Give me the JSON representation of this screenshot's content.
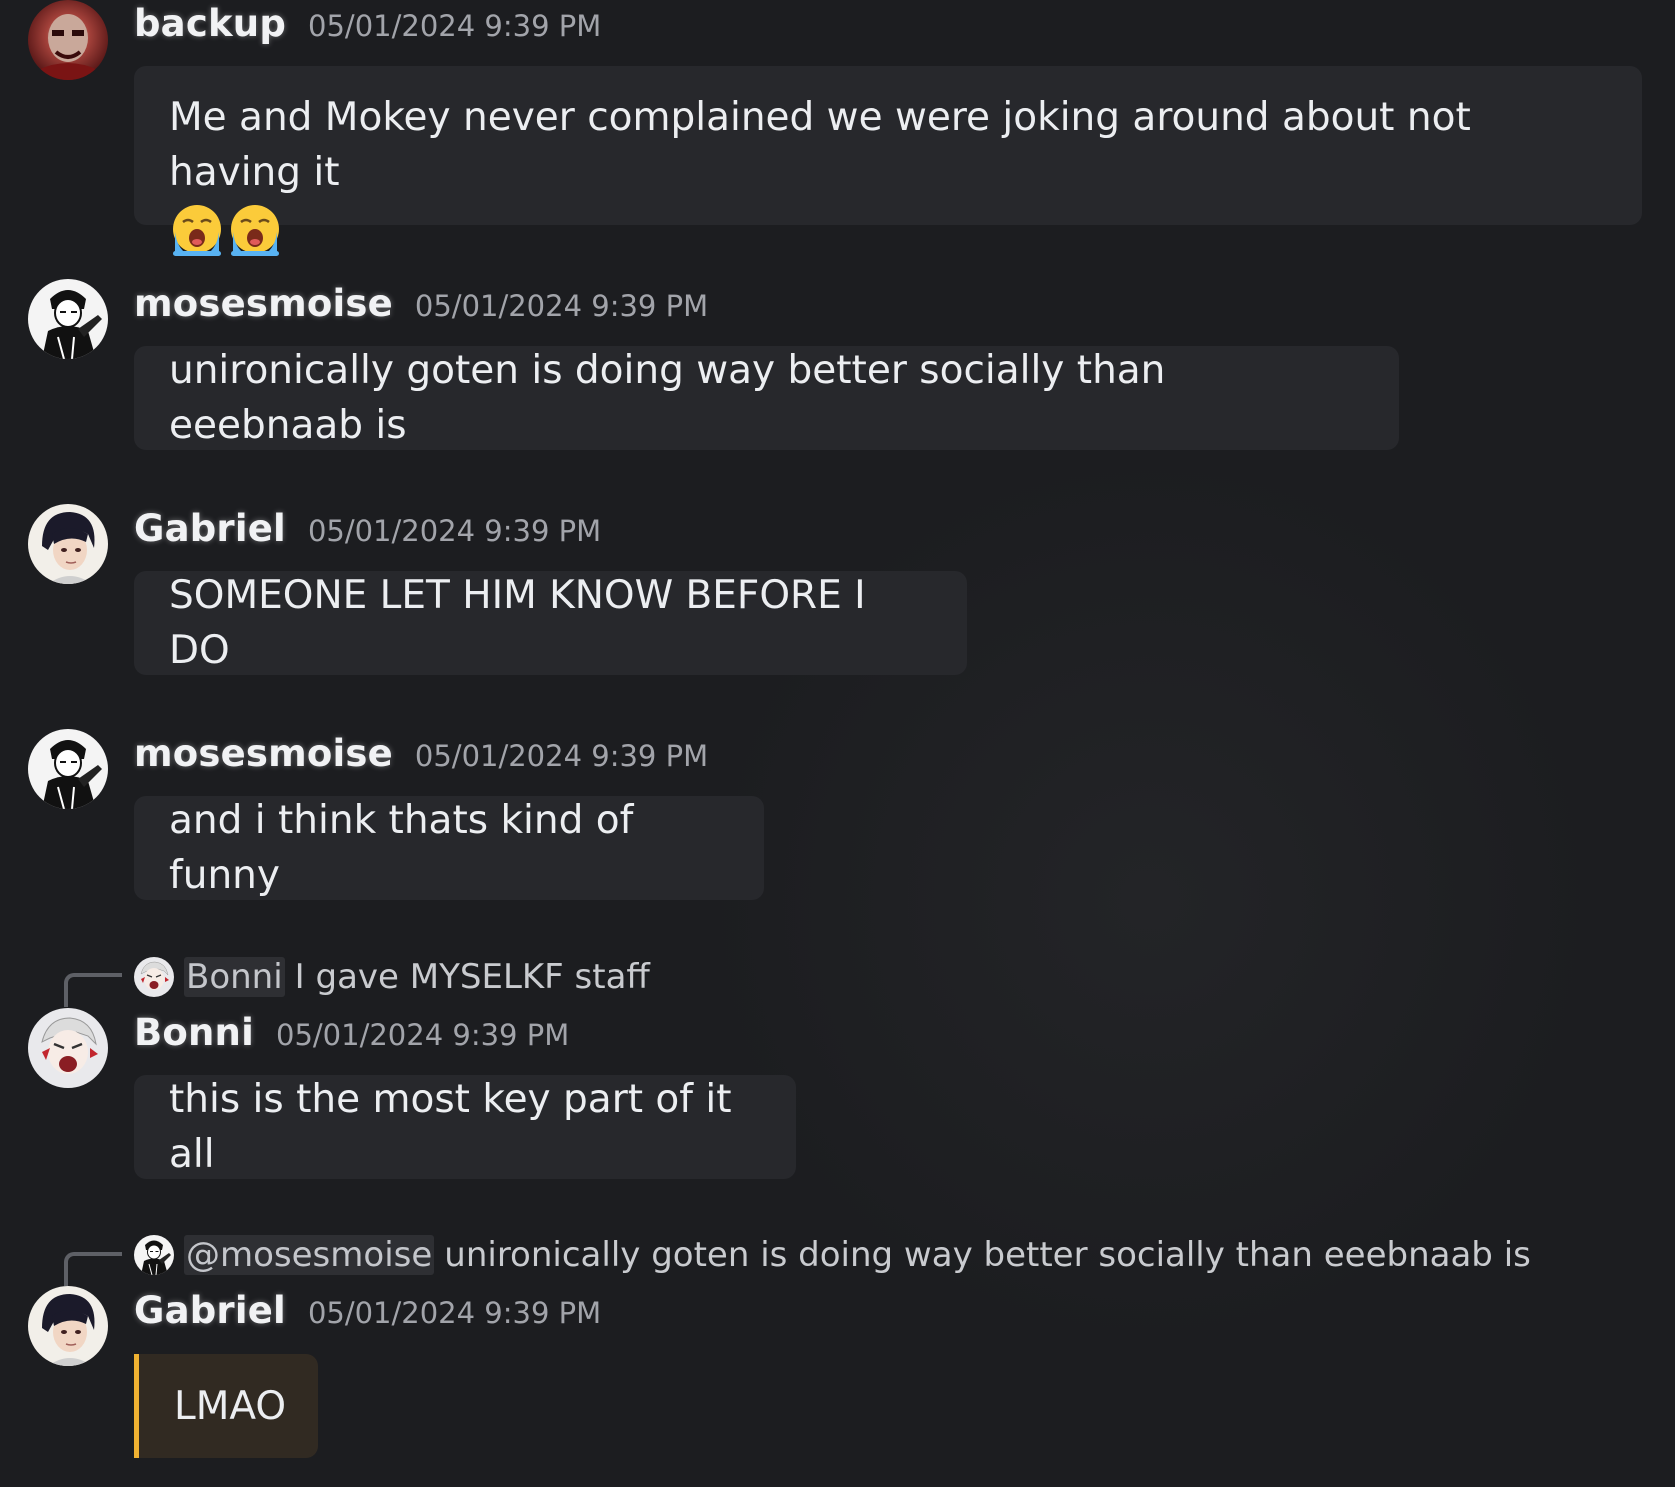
{
  "messages": [
    {
      "author": "backup",
      "timestamp": "05/01/2024 9:39 PM",
      "avatar_icon": "red-skull-avatar-icon",
      "text": "Me and Mokey never complained we were joking around about not having it",
      "emojis": [
        "loudly-crying-face-icon",
        "loudly-crying-face-icon"
      ]
    },
    {
      "author": "mosesmoise",
      "timestamp": "05/01/2024 9:39 PM",
      "avatar_icon": "manga-character-avatar-icon",
      "text": "unironically goten is doing way better socially than eeebnaab is"
    },
    {
      "author": "Gabriel",
      "timestamp": "05/01/2024 9:39 PM",
      "avatar_icon": "anime-boy-avatar-icon",
      "text": "SOMEONE LET HIM KNOW BEFORE I DO"
    },
    {
      "author": "mosesmoise",
      "timestamp": "05/01/2024 9:39 PM",
      "avatar_icon": "manga-character-avatar-icon",
      "text": "and i think thats kind of funny"
    },
    {
      "author": "Bonni",
      "timestamp": "05/01/2024 9:39 PM",
      "avatar_icon": "screaming-character-avatar-icon",
      "reply": {
        "name": "Bonni",
        "text": "I gave MYSELKF staff"
      },
      "text": "this is the most key part of it all"
    },
    {
      "author": "Gabriel",
      "timestamp": "05/01/2024 9:39 PM",
      "avatar_icon": "anime-boy-avatar-icon",
      "reply": {
        "name": "@mosesmoise",
        "text": "unironically goten is doing way better socially than eeebnaab is"
      },
      "text": "LMAO",
      "highlighted": true
    }
  ],
  "colors": {
    "background": "#1c1d20",
    "bubble": "#27282c",
    "mention_highlight_border": "#f0b232",
    "timestamp": "#a2a4aa"
  }
}
